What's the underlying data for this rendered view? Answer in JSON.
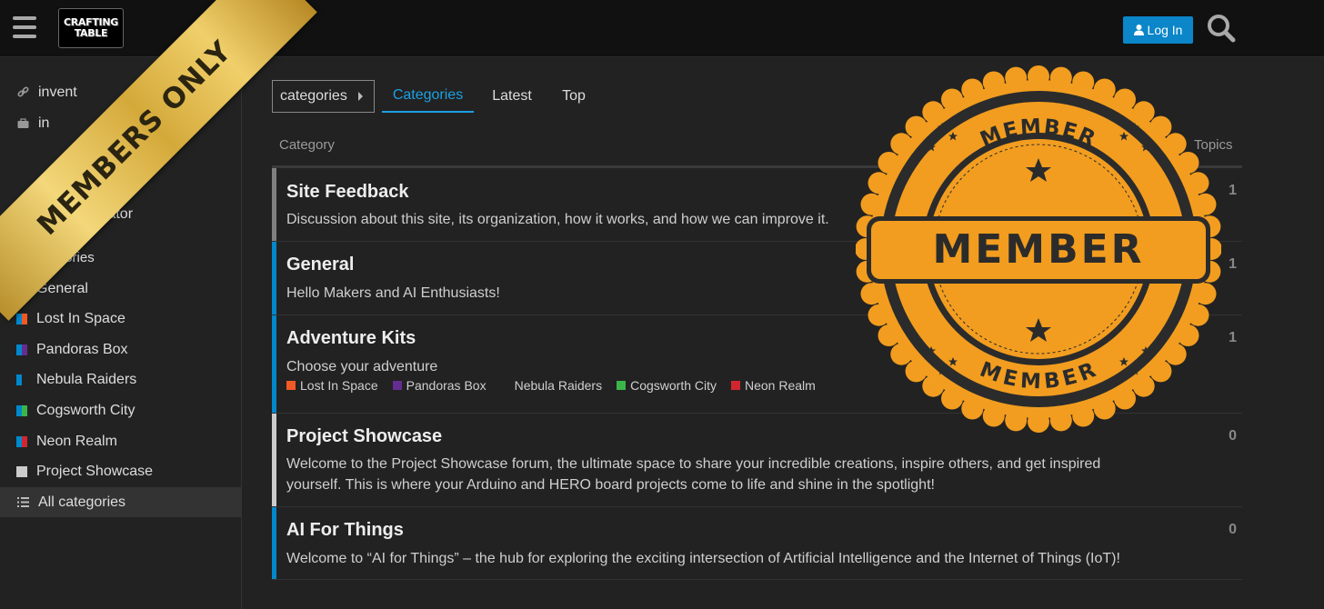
{
  "header": {
    "logo_line1": "CRAFTING",
    "logo_line2": "TABLE",
    "login_label": "Log In"
  },
  "sidebar": {
    "links": [
      {
        "label": "invent",
        "icon": "link-icon"
      },
      {
        "label": "in",
        "icon": "briefcase-icon"
      },
      {
        "label": "ulator",
        "icon": ""
      }
    ],
    "categories_heading": "ategories",
    "categories": [
      {
        "label": "General",
        "colors": [
          "#0088cc",
          "#0088cc"
        ]
      },
      {
        "label": "Lost In Space",
        "colors": [
          "#0088cc",
          "#f15a24"
        ]
      },
      {
        "label": "Pandoras Box",
        "colors": [
          "#0088cc",
          "#652d90"
        ]
      },
      {
        "label": "Nebula Raiders",
        "colors": [
          "#0088cc",
          "#222222"
        ]
      },
      {
        "label": "Cogsworth City",
        "colors": [
          "#0088cc",
          "#3ab54a"
        ]
      },
      {
        "label": "Neon Realm",
        "colors": [
          "#0088cc",
          "#d1262f"
        ]
      },
      {
        "label": "Project Showcase",
        "colors": [
          "#cccccc",
          "#cccccc"
        ]
      }
    ],
    "all_categories": "All categories"
  },
  "nav": {
    "dropdown_label": "categories",
    "tabs": [
      "Categories",
      "Latest",
      "Top"
    ]
  },
  "table": {
    "col_category": "Category",
    "col_topics": "Topics",
    "rows": [
      {
        "title": "Site Feedback",
        "desc": "Discussion about this site, its organization, how it works, and how we can improve it.",
        "count": "1",
        "color": "#808080"
      },
      {
        "title": "General",
        "desc": "Hello Makers and AI Enthusiasts!",
        "count": "1",
        "color": "#0088cc"
      },
      {
        "title": "Adventure Kits",
        "desc": "Choose your adventure",
        "count": "1",
        "color": "#0088cc",
        "subcategories": [
          {
            "label": "Lost In Space",
            "color": "#f15a24"
          },
          {
            "label": "Pandoras Box",
            "color": "#652d90"
          },
          {
            "label": "Nebula Raiders",
            "color": "#222222"
          },
          {
            "label": "Cogsworth City",
            "color": "#3ab54a"
          },
          {
            "label": "Neon Realm",
            "color": "#d1262f"
          }
        ]
      },
      {
        "title": "Project Showcase",
        "desc": "Welcome to the Project Showcase forum, the ultimate space to share your incredible creations, inspire others, and get inspired yourself. This is where your Arduino and HERO board projects come to life and shine in the spotlight!",
        "count": "0",
        "color": "#cccccc"
      },
      {
        "title": "AI For Things",
        "desc": "Welcome to “AI for Things” – the hub for exploring the exciting intersection of Artificial Intelligence and the Internet of Things (IoT)!",
        "count": "0",
        "color": "#0088cc"
      }
    ]
  },
  "overlays": {
    "ribbon_text": "MEMBERS ONLY",
    "seal_top": "MEMBER",
    "seal_center": "MEMBER",
    "seal_bottom": "MEMBER"
  },
  "colors": {
    "accent": "#1ca0e3",
    "login_bg": "#0a86c9",
    "seal_orange": "#f29d1f",
    "seal_dark": "#2b2b2b"
  }
}
